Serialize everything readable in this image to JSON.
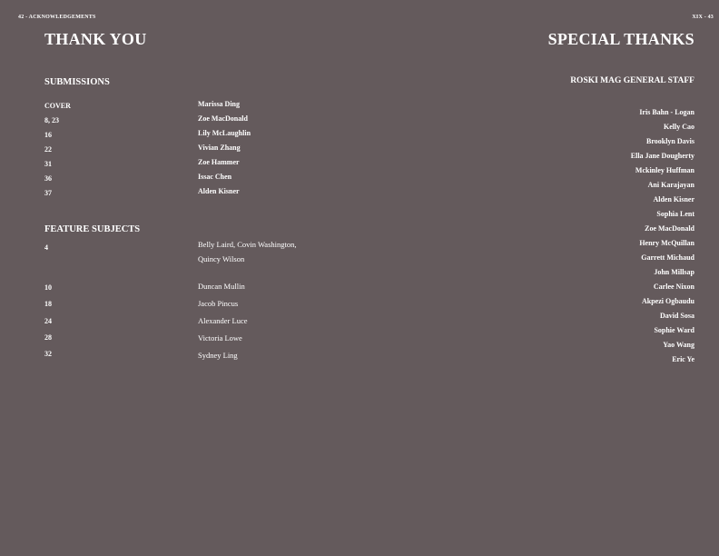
{
  "left_page": {
    "folio": "42 - ACKNOWLEDGEMENTS",
    "title": "THANK YOU",
    "submissions": {
      "heading": "SUBMISSIONS",
      "rows": [
        {
          "page": "COVER",
          "name": "Marissa Ding"
        },
        {
          "page": "8, 23",
          "name": "Zoe MacDonald"
        },
        {
          "page": "16",
          "name": "Lily McLaughlin"
        },
        {
          "page": "22",
          "name": "Vivian Zhang"
        },
        {
          "page": "31",
          "name": "Zoe Hammer"
        },
        {
          "page": "36",
          "name": "Issac Chen"
        },
        {
          "page": "37",
          "name": "Alden Kisner"
        }
      ]
    },
    "features": {
      "heading": "FEATURE SUBJECTS",
      "rows": [
        {
          "page": "4",
          "name_line1": "Belly Laird, Covin Washington,",
          "name_line2": "Quincy Wilson"
        },
        {
          "page": "10",
          "name": "Duncan Mullin"
        },
        {
          "page": "18",
          "name": "Jacob Pincus"
        },
        {
          "page": "24",
          "name": "Alexander Luce"
        },
        {
          "page": "28",
          "name": "Victoria Lowe"
        },
        {
          "page": "32",
          "name": "Sydney Ling"
        }
      ]
    }
  },
  "right_page": {
    "folio": "XIX - 43",
    "title": "SPECIAL THANKS",
    "staff_heading": "ROSKI MAG GENERAL STAFF",
    "staff": [
      "Iris Bahn - Logan",
      "Kelly Cao",
      "Brooklyn Davis",
      "Ella Jane Dougherty",
      "Mckinley Huffman",
      "Ani Karajayan",
      "Alden Kisner",
      "Sophia Lent",
      "Zoe MacDonald",
      "Henry McQuillan",
      "Garrett Michaud",
      "John Millsap",
      "Carlee Nixon",
      "Akpezi Ogbaudu",
      "David Sosa",
      "Sophie Ward",
      "Yao Wang",
      "Eric Ye"
    ]
  },
  "colors": {
    "background": "#645a5c",
    "text": "#ffffff"
  }
}
